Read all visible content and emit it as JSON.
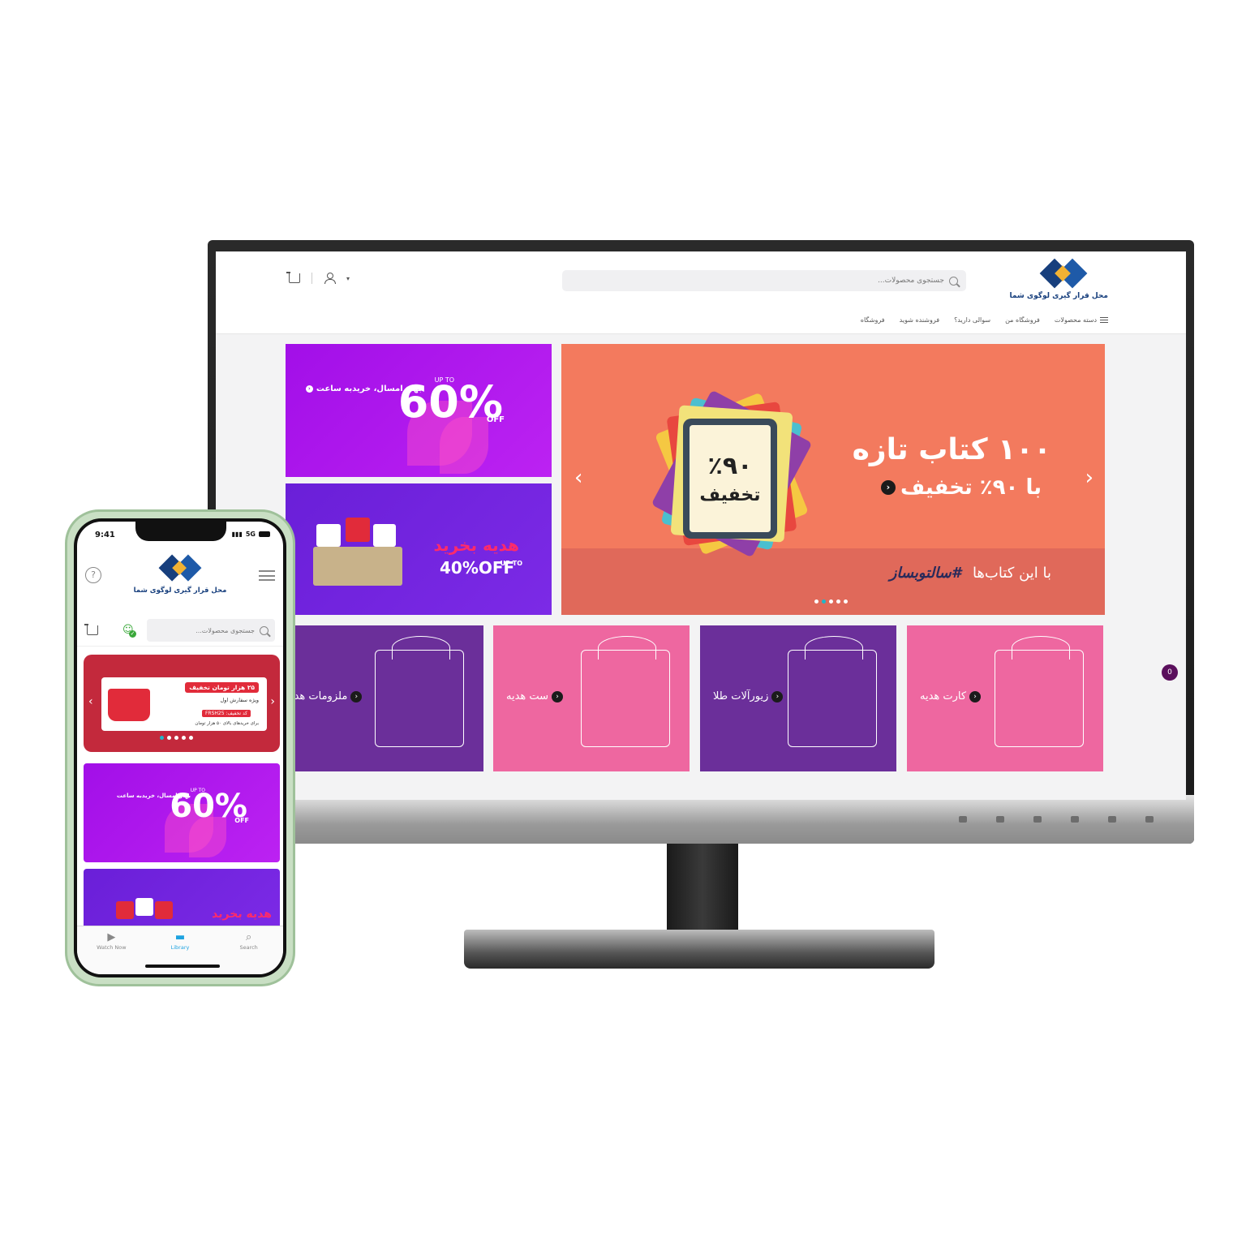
{
  "desktop": {
    "logo_text": "محل قرار گیری لوگوی شما",
    "search_placeholder": "جستجوی محصولات...",
    "nav": [
      "دسته محصولات",
      "فروشگاه من",
      "سوالی دارید؟",
      "فروشنده شوید",
      "فروشگاه"
    ],
    "hero": {
      "title": "۱۰۰ کتاب تازه",
      "subtitle": "با ۹۰٪ تخفیف",
      "tablet_pct": "٪۹۰",
      "tablet_word": "تخفیف",
      "footer": "با این کتاب‌ها",
      "footer_tag": "#سالتو‌بساز",
      "bg_color": "#f37a5e"
    },
    "promo60": {
      "label": "بهار امسال، خریدبه ساعت",
      "upto": "UP TO",
      "big": "60%",
      "off": "OFF"
    },
    "promo_gift": {
      "title": "هدیه بخرید",
      "upto": "UP TO",
      "pct": "40%OFF"
    },
    "categories": [
      {
        "label": "کارت هدیه",
        "color": "#ee67a0"
      },
      {
        "label": "زیورآلات طلا",
        "color": "#6b2f9a"
      },
      {
        "label": "ست هدیه",
        "color": "#ee67a0"
      },
      {
        "label": "ملزومات هدیه",
        "color": "#6b2f9a"
      }
    ],
    "cart_count": "0"
  },
  "phone": {
    "time": "9:41",
    "network": "5G",
    "logo_text": "محل قرار گیری لوگوی شما",
    "search_placeholder": "جستجوی محصولات...",
    "coupon": {
      "title": "۲۵ هزار تومان تخفیف",
      "line1": "ویژه سفارش اول",
      "code": "کد تخفیف: FRSH25",
      "line2": "برای خریدهای بالای ۵۰ هزار تومان"
    },
    "promo60": {
      "label": "بهار امسال، خریدبه ساعت",
      "upto": "UP TO",
      "big": "60%",
      "off": "OFF"
    },
    "promo_gift": {
      "title": "هدیه بخرید"
    },
    "tabs": [
      {
        "label": "Watch Now",
        "icon": "play-icon"
      },
      {
        "label": "Library",
        "icon": "library-icon"
      },
      {
        "label": "Search",
        "icon": "search-icon"
      }
    ]
  }
}
